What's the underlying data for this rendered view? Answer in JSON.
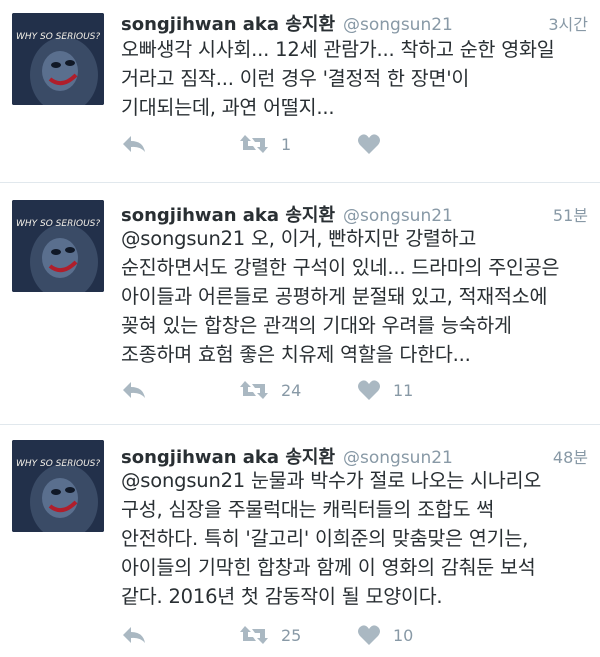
{
  "tweets": [
    {
      "name": "songjihwan aka 송지환",
      "handle": "@songsun21",
      "time": "3시간",
      "text": "오빠생각 시사회... 12세 관람가... 착하고 순한 영화일\n거라고 짐작... 이런 경우 '결정적 한 장면'이\n기대되는데, 과연 어떨지...",
      "retweets": "1",
      "likes": "",
      "avatar_text": "WHY SO SERIOUS?"
    },
    {
      "name": "songjihwan aka 송지환",
      "handle": "@songsun21",
      "time": "51분",
      "text": "@songsun21 오, 이거, 빤하지만 강렬하고\n순진하면서도 강렬한 구석이 있네... 드라마의 주인공은\n아이들과 어른들로 공평하게 분절돼 있고, 적재적소에\n꽂혀 있는 합창은 관객의 기대와 우려를 능숙하게\n조종하며 효험 좋은 치유제 역할을 다한다...",
      "retweets": "24",
      "likes": "11",
      "avatar_text": "WHY SO SERIOUS?"
    },
    {
      "name": "songjihwan aka 송지환",
      "handle": "@songsun21",
      "time": "48분",
      "text": "@songsun21 눈물과 박수가 절로 나오는 시나리오\n구성, 심장을 주물럭대는 캐릭터들의 조합도 썩\n안전하다. 특히 '갈고리' 이희준의 맞춤맞은 연기는,\n아이들의 기막힌 합창과 함께 이 영화의 감춰둔 보석\n같다. 2016년 첫 감동작이 될 모양이다.",
      "retweets": "25",
      "likes": "10",
      "avatar_text": "WHY SO SERIOUS?"
    }
  ],
  "icons": {
    "reply": "reply-arrow-icon",
    "retweet": "retweet-icon",
    "like": "heart-icon"
  },
  "colors": {
    "text": "#292f33",
    "muted": "#8899a6",
    "action": "#aab8c2",
    "divider": "#e1e8ed"
  }
}
